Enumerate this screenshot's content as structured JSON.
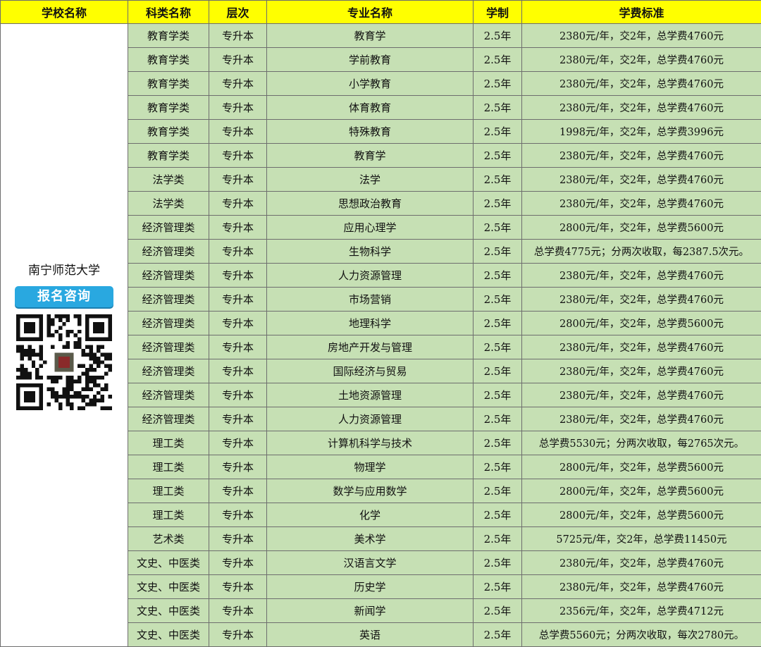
{
  "headers": [
    "学校名称",
    "科类名称",
    "层次",
    "专业名称",
    "学制",
    "学费标准"
  ],
  "school": {
    "name": "南宁师范大学",
    "consult_label": "报名咨询"
  },
  "rows": [
    {
      "category": "教育学类",
      "level": "专升本",
      "major": "教育学",
      "duration": "2.5年",
      "fee": "2380元/年，交2年，总学费4760元"
    },
    {
      "category": "教育学类",
      "level": "专升本",
      "major": "学前教育",
      "duration": "2.5年",
      "fee": "2380元/年，交2年，总学费4760元"
    },
    {
      "category": "教育学类",
      "level": "专升本",
      "major": "小学教育",
      "duration": "2.5年",
      "fee": "2380元/年，交2年，总学费4760元"
    },
    {
      "category": "教育学类",
      "level": "专升本",
      "major": "体育教育",
      "duration": "2.5年",
      "fee": "2380元/年，交2年，总学费4760元"
    },
    {
      "category": "教育学类",
      "level": "专升本",
      "major": "特殊教育",
      "duration": "2.5年",
      "fee": "1998元/年，交2年，总学费3996元"
    },
    {
      "category": "教育学类",
      "level": "专升本",
      "major": "教育学",
      "duration": "2.5年",
      "fee": "2380元/年，交2年，总学费4760元"
    },
    {
      "category": "法学类",
      "level": "专升本",
      "major": "法学",
      "duration": "2.5年",
      "fee": "2380元/年，交2年，总学费4760元"
    },
    {
      "category": "法学类",
      "level": "专升本",
      "major": "思想政治教育",
      "duration": "2.5年",
      "fee": "2380元/年，交2年，总学费4760元"
    },
    {
      "category": "经济管理类",
      "level": "专升本",
      "major": "应用心理学",
      "duration": "2.5年",
      "fee": "2800元/年，交2年，总学费5600元"
    },
    {
      "category": "经济管理类",
      "level": "专升本",
      "major": "生物科学",
      "duration": "2.5年",
      "fee": "总学费4775元；分两次收取，每2387.5次元。"
    },
    {
      "category": "经济管理类",
      "level": "专升本",
      "major": "人力资源管理",
      "duration": "2.5年",
      "fee": "2380元/年，交2年，总学费4760元"
    },
    {
      "category": "经济管理类",
      "level": "专升本",
      "major": "市场营销",
      "duration": "2.5年",
      "fee": "2380元/年，交2年，总学费4760元"
    },
    {
      "category": "经济管理类",
      "level": "专升本",
      "major": "地理科学",
      "duration": "2.5年",
      "fee": "2800元/年，交2年，总学费5600元"
    },
    {
      "category": "经济管理类",
      "level": "专升本",
      "major": "房地产开发与管理",
      "duration": "2.5年",
      "fee": "2380元/年，交2年，总学费4760元"
    },
    {
      "category": "经济管理类",
      "level": "专升本",
      "major": "国际经济与贸易",
      "duration": "2.5年",
      "fee": "2380元/年，交2年，总学费4760元"
    },
    {
      "category": "经济管理类",
      "level": "专升本",
      "major": "土地资源管理",
      "duration": "2.5年",
      "fee": "2380元/年，交2年，总学费4760元"
    },
    {
      "category": "经济管理类",
      "level": "专升本",
      "major": "人力资源管理",
      "duration": "2.5年",
      "fee": "2380元/年，交2年，总学费4760元"
    },
    {
      "category": "理工类",
      "level": "专升本",
      "major": "计算机科学与技术",
      "duration": "2.5年",
      "fee": "总学费5530元；分两次收取，每2765次元。"
    },
    {
      "category": "理工类",
      "level": "专升本",
      "major": "物理学",
      "duration": "2.5年",
      "fee": "2800元/年，交2年，总学费5600元"
    },
    {
      "category": "理工类",
      "level": "专升本",
      "major": "数学与应用数学",
      "duration": "2.5年",
      "fee": "2800元/年，交2年，总学费5600元"
    },
    {
      "category": "理工类",
      "level": "专升本",
      "major": "化学",
      "duration": "2.5年",
      "fee": "2800元/年，交2年，总学费5600元"
    },
    {
      "category": "艺术类",
      "level": "专升本",
      "major": "美术学",
      "duration": "2.5年",
      "fee": "5725元/年，交2年，总学费11450元"
    },
    {
      "category": "文史、中医类",
      "level": "专升本",
      "major": "汉语言文学",
      "duration": "2.5年",
      "fee": "2380元/年，交2年，总学费4760元"
    },
    {
      "category": "文史、中医类",
      "level": "专升本",
      "major": "历史学",
      "duration": "2.5年",
      "fee": "2380元/年，交2年，总学费4760元"
    },
    {
      "category": "文史、中医类",
      "level": "专升本",
      "major": "新闻学",
      "duration": "2.5年",
      "fee": "2356元/年，交2年，总学费4712元"
    },
    {
      "category": "文史、中医类",
      "level": "专升本",
      "major": "英语",
      "duration": "2.5年",
      "fee": "总学费5560元；分两次收取，每次2780元。"
    }
  ]
}
